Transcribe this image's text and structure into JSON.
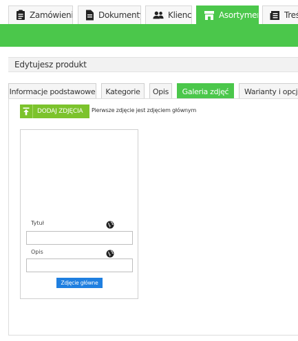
{
  "nav": {
    "tabs": [
      {
        "label": "Zamówienia",
        "icon": "clipboard-icon"
      },
      {
        "label": "Dokumenty",
        "icon": "document-icon"
      },
      {
        "label": "Klienci",
        "icon": "users-icon"
      },
      {
        "label": "Asortyment",
        "icon": "shop-icon"
      },
      {
        "label": "Treść",
        "icon": "news-icon"
      }
    ],
    "active": "Asortyment"
  },
  "header": {
    "title": "Edytujesz produkt"
  },
  "subtabs": {
    "items": [
      {
        "label": "Informacje podstawowe"
      },
      {
        "label": "Kategorie"
      },
      {
        "label": "Opis"
      },
      {
        "label": "Galeria zdjęć"
      },
      {
        "label": "Warianty i opcje"
      }
    ],
    "active": "Galeria zdjęć"
  },
  "gallery": {
    "add_button_label": "DODAJ ZDJĘCIA",
    "note": "Pierwsze zdjęcie jest zdjęciem głównym",
    "card": {
      "title_label": "Tytuł",
      "title_value": "",
      "desc_label": "Opis",
      "desc_value": "",
      "main_button_label": "Zdjęcie główne"
    }
  },
  "colors": {
    "accent_green": "#4bc74b",
    "button_green": "#7cc32c",
    "button_blue": "#1f7fe0"
  }
}
